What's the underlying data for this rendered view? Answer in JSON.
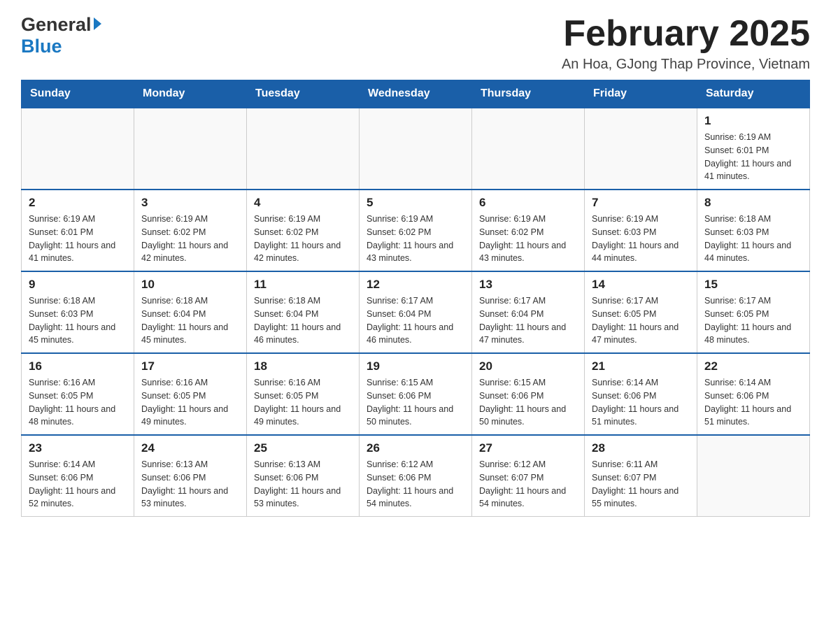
{
  "header": {
    "logo_general": "General",
    "logo_blue": "Blue",
    "month_title": "February 2025",
    "location": "An Hoa, GJong Thap Province, Vietnam"
  },
  "days_of_week": [
    "Sunday",
    "Monday",
    "Tuesday",
    "Wednesday",
    "Thursday",
    "Friday",
    "Saturday"
  ],
  "weeks": [
    {
      "days": [
        {
          "number": "",
          "sunrise": "",
          "sunset": "",
          "daylight": ""
        },
        {
          "number": "",
          "sunrise": "",
          "sunset": "",
          "daylight": ""
        },
        {
          "number": "",
          "sunrise": "",
          "sunset": "",
          "daylight": ""
        },
        {
          "number": "",
          "sunrise": "",
          "sunset": "",
          "daylight": ""
        },
        {
          "number": "",
          "sunrise": "",
          "sunset": "",
          "daylight": ""
        },
        {
          "number": "",
          "sunrise": "",
          "sunset": "",
          "daylight": ""
        },
        {
          "number": "1",
          "sunrise": "Sunrise: 6:19 AM",
          "sunset": "Sunset: 6:01 PM",
          "daylight": "Daylight: 11 hours and 41 minutes."
        }
      ]
    },
    {
      "days": [
        {
          "number": "2",
          "sunrise": "Sunrise: 6:19 AM",
          "sunset": "Sunset: 6:01 PM",
          "daylight": "Daylight: 11 hours and 41 minutes."
        },
        {
          "number": "3",
          "sunrise": "Sunrise: 6:19 AM",
          "sunset": "Sunset: 6:02 PM",
          "daylight": "Daylight: 11 hours and 42 minutes."
        },
        {
          "number": "4",
          "sunrise": "Sunrise: 6:19 AM",
          "sunset": "Sunset: 6:02 PM",
          "daylight": "Daylight: 11 hours and 42 minutes."
        },
        {
          "number": "5",
          "sunrise": "Sunrise: 6:19 AM",
          "sunset": "Sunset: 6:02 PM",
          "daylight": "Daylight: 11 hours and 43 minutes."
        },
        {
          "number": "6",
          "sunrise": "Sunrise: 6:19 AM",
          "sunset": "Sunset: 6:02 PM",
          "daylight": "Daylight: 11 hours and 43 minutes."
        },
        {
          "number": "7",
          "sunrise": "Sunrise: 6:19 AM",
          "sunset": "Sunset: 6:03 PM",
          "daylight": "Daylight: 11 hours and 44 minutes."
        },
        {
          "number": "8",
          "sunrise": "Sunrise: 6:18 AM",
          "sunset": "Sunset: 6:03 PM",
          "daylight": "Daylight: 11 hours and 44 minutes."
        }
      ]
    },
    {
      "days": [
        {
          "number": "9",
          "sunrise": "Sunrise: 6:18 AM",
          "sunset": "Sunset: 6:03 PM",
          "daylight": "Daylight: 11 hours and 45 minutes."
        },
        {
          "number": "10",
          "sunrise": "Sunrise: 6:18 AM",
          "sunset": "Sunset: 6:04 PM",
          "daylight": "Daylight: 11 hours and 45 minutes."
        },
        {
          "number": "11",
          "sunrise": "Sunrise: 6:18 AM",
          "sunset": "Sunset: 6:04 PM",
          "daylight": "Daylight: 11 hours and 46 minutes."
        },
        {
          "number": "12",
          "sunrise": "Sunrise: 6:17 AM",
          "sunset": "Sunset: 6:04 PM",
          "daylight": "Daylight: 11 hours and 46 minutes."
        },
        {
          "number": "13",
          "sunrise": "Sunrise: 6:17 AM",
          "sunset": "Sunset: 6:04 PM",
          "daylight": "Daylight: 11 hours and 47 minutes."
        },
        {
          "number": "14",
          "sunrise": "Sunrise: 6:17 AM",
          "sunset": "Sunset: 6:05 PM",
          "daylight": "Daylight: 11 hours and 47 minutes."
        },
        {
          "number": "15",
          "sunrise": "Sunrise: 6:17 AM",
          "sunset": "Sunset: 6:05 PM",
          "daylight": "Daylight: 11 hours and 48 minutes."
        }
      ]
    },
    {
      "days": [
        {
          "number": "16",
          "sunrise": "Sunrise: 6:16 AM",
          "sunset": "Sunset: 6:05 PM",
          "daylight": "Daylight: 11 hours and 48 minutes."
        },
        {
          "number": "17",
          "sunrise": "Sunrise: 6:16 AM",
          "sunset": "Sunset: 6:05 PM",
          "daylight": "Daylight: 11 hours and 49 minutes."
        },
        {
          "number": "18",
          "sunrise": "Sunrise: 6:16 AM",
          "sunset": "Sunset: 6:05 PM",
          "daylight": "Daylight: 11 hours and 49 minutes."
        },
        {
          "number": "19",
          "sunrise": "Sunrise: 6:15 AM",
          "sunset": "Sunset: 6:06 PM",
          "daylight": "Daylight: 11 hours and 50 minutes."
        },
        {
          "number": "20",
          "sunrise": "Sunrise: 6:15 AM",
          "sunset": "Sunset: 6:06 PM",
          "daylight": "Daylight: 11 hours and 50 minutes."
        },
        {
          "number": "21",
          "sunrise": "Sunrise: 6:14 AM",
          "sunset": "Sunset: 6:06 PM",
          "daylight": "Daylight: 11 hours and 51 minutes."
        },
        {
          "number": "22",
          "sunrise": "Sunrise: 6:14 AM",
          "sunset": "Sunset: 6:06 PM",
          "daylight": "Daylight: 11 hours and 51 minutes."
        }
      ]
    },
    {
      "days": [
        {
          "number": "23",
          "sunrise": "Sunrise: 6:14 AM",
          "sunset": "Sunset: 6:06 PM",
          "daylight": "Daylight: 11 hours and 52 minutes."
        },
        {
          "number": "24",
          "sunrise": "Sunrise: 6:13 AM",
          "sunset": "Sunset: 6:06 PM",
          "daylight": "Daylight: 11 hours and 53 minutes."
        },
        {
          "number": "25",
          "sunrise": "Sunrise: 6:13 AM",
          "sunset": "Sunset: 6:06 PM",
          "daylight": "Daylight: 11 hours and 53 minutes."
        },
        {
          "number": "26",
          "sunrise": "Sunrise: 6:12 AM",
          "sunset": "Sunset: 6:06 PM",
          "daylight": "Daylight: 11 hours and 54 minutes."
        },
        {
          "number": "27",
          "sunrise": "Sunrise: 6:12 AM",
          "sunset": "Sunset: 6:07 PM",
          "daylight": "Daylight: 11 hours and 54 minutes."
        },
        {
          "number": "28",
          "sunrise": "Sunrise: 6:11 AM",
          "sunset": "Sunset: 6:07 PM",
          "daylight": "Daylight: 11 hours and 55 minutes."
        },
        {
          "number": "",
          "sunrise": "",
          "sunset": "",
          "daylight": ""
        }
      ]
    }
  ]
}
